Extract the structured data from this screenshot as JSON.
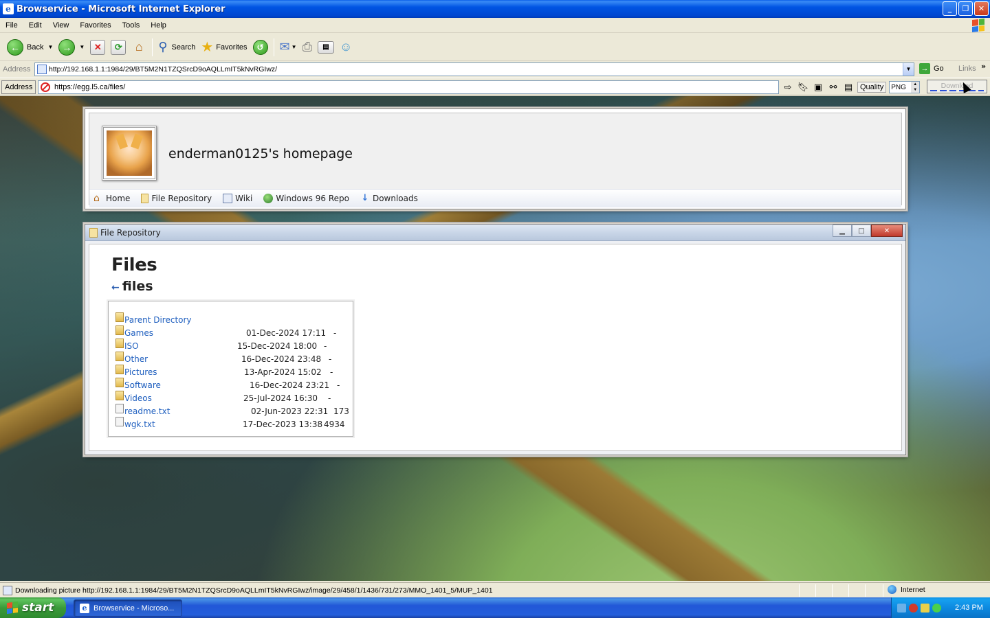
{
  "window": {
    "title": "Browservice - Microsoft Internet Explorer"
  },
  "menu": [
    "File",
    "Edit",
    "View",
    "Favorites",
    "Tools",
    "Help"
  ],
  "toolbar": {
    "back": "Back",
    "search": "Search",
    "favorites": "Favorites"
  },
  "address": {
    "label": "Address",
    "url": "http://192.168.1.1:1984/29/BT5M2N1TZQSrcD9oAQLLmIT5kNvRGIwz/",
    "go": "Go",
    "links": "Links"
  },
  "proxy": {
    "label": "Address",
    "url": "https://egg.l5.ca/files/",
    "quality_label": "Quality",
    "quality_value": "PNG",
    "download": "Download"
  },
  "site": {
    "title": "enderman0125's homepage",
    "nav": [
      {
        "label": "Home",
        "icon": "home-icon"
      },
      {
        "label": "File Repository",
        "icon": "folder-icon"
      },
      {
        "label": "Wiki",
        "icon": "book-icon"
      },
      {
        "label": "Windows 96 Repo",
        "icon": "globe-icon"
      },
      {
        "label": "Downloads",
        "icon": "download-arrow-icon"
      }
    ]
  },
  "file_window": {
    "title": "File Repository",
    "heading": "Files",
    "back_arrow": "←",
    "path": "files",
    "entries": [
      {
        "name": "Parent Directory",
        "date": "",
        "size": "",
        "type": "folder"
      },
      {
        "name": "Games",
        "date": "01-Dec-2024 17:11",
        "size": "-",
        "type": "folder"
      },
      {
        "name": "ISO",
        "date": "15-Dec-2024 18:00",
        "size": "-",
        "type": "folder"
      },
      {
        "name": "Other",
        "date": "16-Dec-2024 23:48",
        "size": "-",
        "type": "folder"
      },
      {
        "name": "Pictures",
        "date": "13-Apr-2024 15:02",
        "size": "-",
        "type": "folder"
      },
      {
        "name": "Software",
        "date": "16-Dec-2024 23:21",
        "size": "-",
        "type": "folder"
      },
      {
        "name": "Videos",
        "date": "25-Jul-2024 16:30",
        "size": "-",
        "type": "folder"
      },
      {
        "name": "readme.txt",
        "date": "02-Jun-2023 22:31",
        "size": "173",
        "type": "file"
      },
      {
        "name": "wgk.txt",
        "date": "17-Dec-2023 13:38",
        "size": "4934",
        "type": "file"
      }
    ]
  },
  "status": {
    "text": "Downloading picture http://192.168.1.1:1984/29/BT5M2N1TZQSrcD9oAQLLmIT5kNvRGIwz/image/29/458/1/1436/731/273/MMO_1401_5/MUP_1401",
    "zone": "Internet"
  },
  "taskbar": {
    "start": "start",
    "task": "Browservice - Microso...",
    "clock": "2:43 PM"
  }
}
